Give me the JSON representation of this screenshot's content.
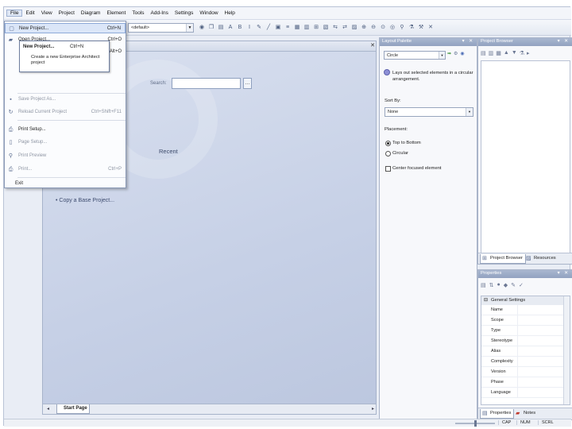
{
  "menu": [
    "File",
    "Edit",
    "View",
    "Project",
    "Diagram",
    "Element",
    "Tools",
    "Add-Ins",
    "Settings",
    "Window",
    "Help"
  ],
  "toolbar": {
    "perspective_value": "<default>"
  },
  "file_menu": {
    "items": [
      {
        "label": "New Project...",
        "shortcut": "Ctrl+N",
        "icon": "new-project-icon",
        "state": "highlighted"
      },
      {
        "label": "Open Project...",
        "shortcut": "Ctrl+O",
        "icon": "open-folder-icon",
        "state": "normal"
      },
      {
        "label": "",
        "shortcut": "Alt+O",
        "icon": "",
        "state": "normal"
      },
      {
        "label": "Save Project As...",
        "shortcut": "",
        "icon": "save-icon",
        "state": "disabled"
      },
      {
        "label": "Reload Current Project",
        "shortcut": "Ctrl+Shift+F11",
        "icon": "reload-icon",
        "state": "disabled"
      },
      {
        "label": "Print Setup...",
        "shortcut": "",
        "icon": "printer-icon",
        "state": "normal"
      },
      {
        "label": "Page Setup...",
        "shortcut": "",
        "icon": "page-icon",
        "state": "disabled"
      },
      {
        "label": "Print Preview",
        "shortcut": "",
        "icon": "print-preview-icon",
        "state": "disabled"
      },
      {
        "label": "Print...",
        "shortcut": "Ctrl+P",
        "icon": "print-icon",
        "state": "disabled"
      },
      {
        "label": "Exit",
        "shortcut": "",
        "icon": "",
        "state": "normal"
      }
    ]
  },
  "tooltip": {
    "title": "New Project...",
    "shortcut": "Ctrl+N",
    "description": "Create a new Enterprise Architect project"
  },
  "start_page": {
    "search_label": "Search:",
    "recent_label": "Recent",
    "copy_base_link": "• Copy a Base Project...",
    "tab_label": "Start Page"
  },
  "layout_palette": {
    "title": "Layout Palette",
    "layout_value": "Circle",
    "description": "Lays out selected elements in a circular arrangement.",
    "sort_by_label": "Sort By:",
    "sort_by_value": "None",
    "placement_label": "Placement:",
    "radio_top_to_bottom": "Top to Bottom",
    "radio_circular": "Circular",
    "checkbox_center": "Center focused element"
  },
  "project_browser": {
    "title": "Project Browser",
    "tabs": [
      {
        "label": "Project Browser",
        "active": true
      },
      {
        "label": "Resources",
        "active": false
      }
    ]
  },
  "properties": {
    "title": "Properties",
    "group": "General Settings",
    "rows": [
      "Name",
      "Scope",
      "Type",
      "Stereotype",
      "Alias",
      "Complexity",
      "Version",
      "Phase",
      "Language"
    ],
    "tabs": [
      {
        "label": "Properties",
        "active": true
      },
      {
        "label": "Notes",
        "active": false
      }
    ]
  },
  "status": [
    "CAP",
    "NUM",
    "SCRL"
  ]
}
